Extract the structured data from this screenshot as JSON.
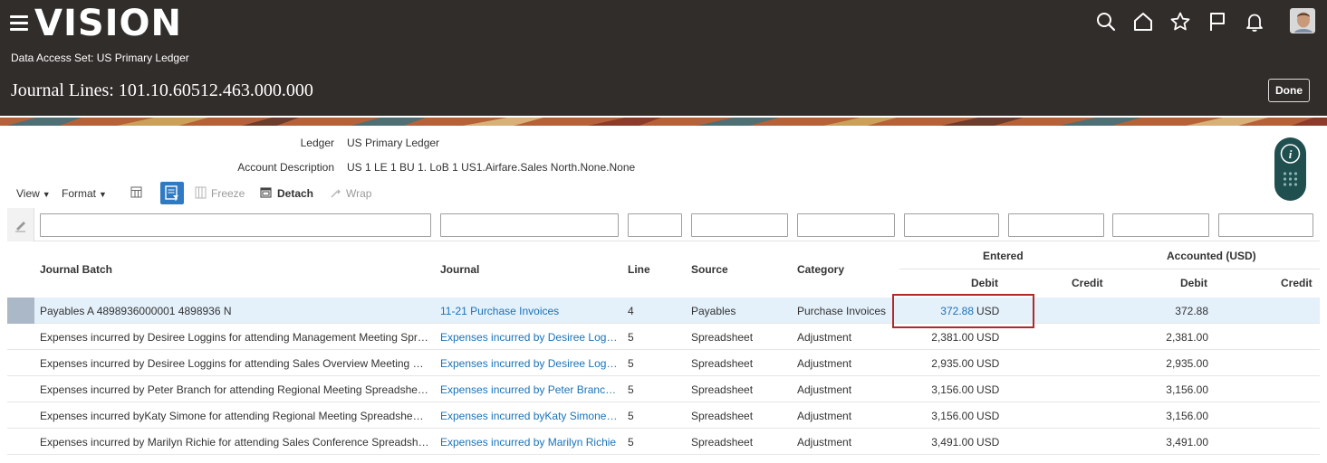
{
  "header": {
    "logo": "VISION",
    "data_access_label": "Data Access Set:",
    "data_access_value": "US Primary Ledger",
    "page_title": "Journal Lines: 101.10.60512.463.000.000",
    "done_label": "Done"
  },
  "details": {
    "ledger_label": "Ledger",
    "ledger_value": "US Primary Ledger",
    "account_desc_label": "Account Description",
    "account_desc_value": "US 1 LE 1 BU 1. LoB 1 US1.Airfare.Sales North.None.None"
  },
  "toolbar": {
    "view": "View",
    "format": "Format",
    "freeze": "Freeze",
    "detach": "Detach",
    "wrap": "Wrap"
  },
  "table": {
    "columns": {
      "journal_batch": "Journal Batch",
      "journal": "Journal",
      "line": "Line",
      "source": "Source",
      "category": "Category",
      "entered": "Entered",
      "accounted": "Accounted (USD)",
      "debit": "Debit",
      "credit": "Credit"
    },
    "rows": [
      {
        "batch": "Payables A 4898936000001 4898936 N",
        "journal": "11-21 Purchase Invoices",
        "line": "4",
        "source": "Payables",
        "category": "Purchase Invoices",
        "entered_debit": "372.88",
        "entered_currency": "USD",
        "accounted_debit": "372.88"
      },
      {
        "batch": "Expenses incurred by Desiree Loggins for attending Management Meeting Spreadsheet A",
        "journal": "Expenses incurred by Desiree Loggins",
        "line": "5",
        "source": "Spreadsheet",
        "category": "Adjustment",
        "entered_debit": "2,381.00",
        "entered_currency": "USD",
        "accounted_debit": "2,381.00"
      },
      {
        "batch": "Expenses incurred by Desiree Loggins for attending Sales Overview Meeting Spreadsheet A",
        "journal": "Expenses incurred by Desiree Loggins",
        "line": "5",
        "source": "Spreadsheet",
        "category": "Adjustment",
        "entered_debit": "2,935.00",
        "entered_currency": "USD",
        "accounted_debit": "2,935.00"
      },
      {
        "batch": "Expenses incurred by Peter Branch for attending Regional Meeting Spreadsheet A",
        "journal": "Expenses incurred by Peter Branch for",
        "line": "5",
        "source": "Spreadsheet",
        "category": "Adjustment",
        "entered_debit": "3,156.00",
        "entered_currency": "USD",
        "accounted_debit": "3,156.00"
      },
      {
        "batch": "Expenses incurred byKaty Simone for attending Regional Meeting Spreadsheet A",
        "journal": "Expenses incurred byKaty Simone for",
        "line": "5",
        "source": "Spreadsheet",
        "category": "Adjustment",
        "entered_debit": "3,156.00",
        "entered_currency": "USD",
        "accounted_debit": "3,156.00"
      },
      {
        "batch": "Expenses incurred by Marilyn Richie for attending Sales Conference Spreadsheet A",
        "journal": "Expenses incurred by Marilyn Richie",
        "line": "5",
        "source": "Spreadsheet",
        "category": "Adjustment",
        "entered_debit": "3,491.00",
        "entered_currency": "USD",
        "accounted_debit": "3,491.00"
      }
    ]
  },
  "colors": {
    "header_bg": "#312d2a",
    "link": "#1a73b8",
    "selected_row": "#e4f0fa",
    "highlight_border": "#b02a2a",
    "qbe_button": "#2f7ac2"
  }
}
